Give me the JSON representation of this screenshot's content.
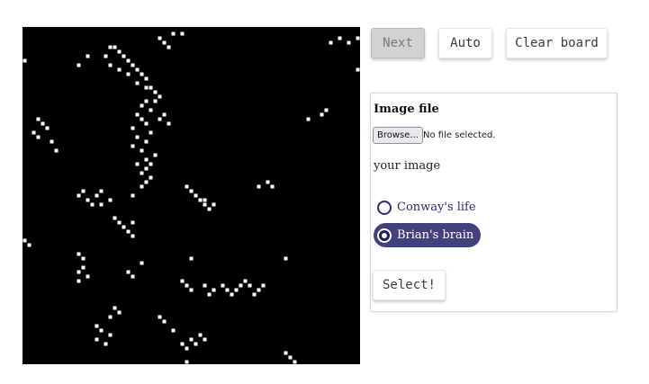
{
  "toolbar": {
    "next_label": "Next",
    "auto_label": "Auto",
    "clear_label": "Clear board"
  },
  "form": {
    "image_file_heading": "Image file",
    "browse_label": "Browse...",
    "file_status": "No file selected.",
    "your_image_label": "your image",
    "options": [
      {
        "label": "Conway's life",
        "selected": false
      },
      {
        "label": "Brian's brain",
        "selected": true
      }
    ],
    "select_label": "Select!"
  },
  "colors": {
    "board_background": "#000000",
    "cell_alive": "#ffffff",
    "selected_option_bg": "#43417c"
  },
  "board": {
    "columns": 75,
    "rows": 75,
    "live_cells": [
      [
        19,
        4
      ],
      [
        20,
        4
      ],
      [
        21,
        5
      ],
      [
        22,
        6
      ],
      [
        23,
        7
      ],
      [
        24,
        8
      ],
      [
        25,
        9
      ],
      [
        26,
        10
      ],
      [
        27,
        11
      ],
      [
        28,
        13
      ],
      [
        29,
        14
      ],
      [
        30,
        15
      ],
      [
        27,
        16
      ],
      [
        28,
        18
      ],
      [
        18,
        6
      ],
      [
        19,
        8
      ],
      [
        21,
        9
      ],
      [
        23,
        10
      ],
      [
        25,
        12
      ],
      [
        27,
        13
      ],
      [
        29,
        16
      ],
      [
        26,
        17
      ],
      [
        30,
        2
      ],
      [
        31,
        3
      ],
      [
        32,
        4
      ],
      [
        33,
        1
      ],
      [
        35,
        1
      ],
      [
        12,
        8
      ],
      [
        14,
        6
      ],
      [
        0,
        7
      ],
      [
        68,
        3
      ],
      [
        70,
        2
      ],
      [
        72,
        3
      ],
      [
        74,
        2
      ],
      [
        74,
        9
      ],
      [
        3,
        20
      ],
      [
        4,
        21
      ],
      [
        5,
        22
      ],
      [
        2,
        23
      ],
      [
        3,
        24
      ],
      [
        6,
        25
      ],
      [
        7,
        27
      ],
      [
        25,
        19
      ],
      [
        26,
        20
      ],
      [
        27,
        21
      ],
      [
        24,
        22
      ],
      [
        28,
        23
      ],
      [
        25,
        24
      ],
      [
        27,
        25
      ],
      [
        24,
        26
      ],
      [
        26,
        27
      ],
      [
        29,
        28
      ],
      [
        27,
        29
      ],
      [
        25,
        30
      ],
      [
        28,
        30
      ],
      [
        27,
        31
      ],
      [
        26,
        32
      ],
      [
        28,
        33
      ],
      [
        27,
        34
      ],
      [
        26,
        35
      ],
      [
        31,
        19
      ],
      [
        30,
        20
      ],
      [
        32,
        21
      ],
      [
        66,
        19
      ],
      [
        67,
        18
      ],
      [
        63,
        20
      ],
      [
        13,
        36
      ],
      [
        12,
        37
      ],
      [
        14,
        38
      ],
      [
        15,
        39
      ],
      [
        16,
        37
      ],
      [
        17,
        36
      ],
      [
        19,
        38
      ],
      [
        17,
        39
      ],
      [
        24,
        37
      ],
      [
        36,
        35
      ],
      [
        37,
        36
      ],
      [
        38,
        37
      ],
      [
        39,
        38
      ],
      [
        40,
        39
      ],
      [
        41,
        40
      ],
      [
        40,
        38
      ],
      [
        42,
        39
      ],
      [
        20,
        42
      ],
      [
        21,
        43
      ],
      [
        22,
        44
      ],
      [
        23,
        45
      ],
      [
        24,
        46
      ],
      [
        24,
        43
      ],
      [
        54,
        34
      ],
      [
        55,
        35
      ],
      [
        52,
        35
      ],
      [
        0,
        47
      ],
      [
        1,
        48
      ],
      [
        12,
        50
      ],
      [
        13,
        51
      ],
      [
        13,
        53
      ],
      [
        12,
        54
      ],
      [
        14,
        55
      ],
      [
        12,
        56
      ],
      [
        23,
        54
      ],
      [
        24,
        55
      ],
      [
        26,
        52
      ],
      [
        37,
        51
      ],
      [
        58,
        51
      ],
      [
        35,
        56
      ],
      [
        36,
        57
      ],
      [
        37,
        58
      ],
      [
        40,
        57
      ],
      [
        41,
        59
      ],
      [
        42,
        58
      ],
      [
        44,
        57
      ],
      [
        45,
        58
      ],
      [
        46,
        59
      ],
      [
        47,
        58
      ],
      [
        48,
        57
      ],
      [
        49,
        56
      ],
      [
        50,
        57
      ],
      [
        51,
        59
      ],
      [
        52,
        58
      ],
      [
        53,
        57
      ],
      [
        20,
        62
      ],
      [
        21,
        63
      ],
      [
        19,
        64
      ],
      [
        16,
        66
      ],
      [
        17,
        67
      ],
      [
        19,
        68
      ],
      [
        16,
        69
      ],
      [
        18,
        70
      ],
      [
        30,
        64
      ],
      [
        31,
        65
      ],
      [
        33,
        67
      ],
      [
        35,
        70
      ],
      [
        36,
        71
      ],
      [
        37,
        69
      ],
      [
        38,
        70
      ],
      [
        39,
        68
      ],
      [
        40,
        69
      ],
      [
        58,
        72
      ],
      [
        59,
        73
      ],
      [
        60,
        74
      ],
      [
        36,
        74
      ]
    ]
  }
}
